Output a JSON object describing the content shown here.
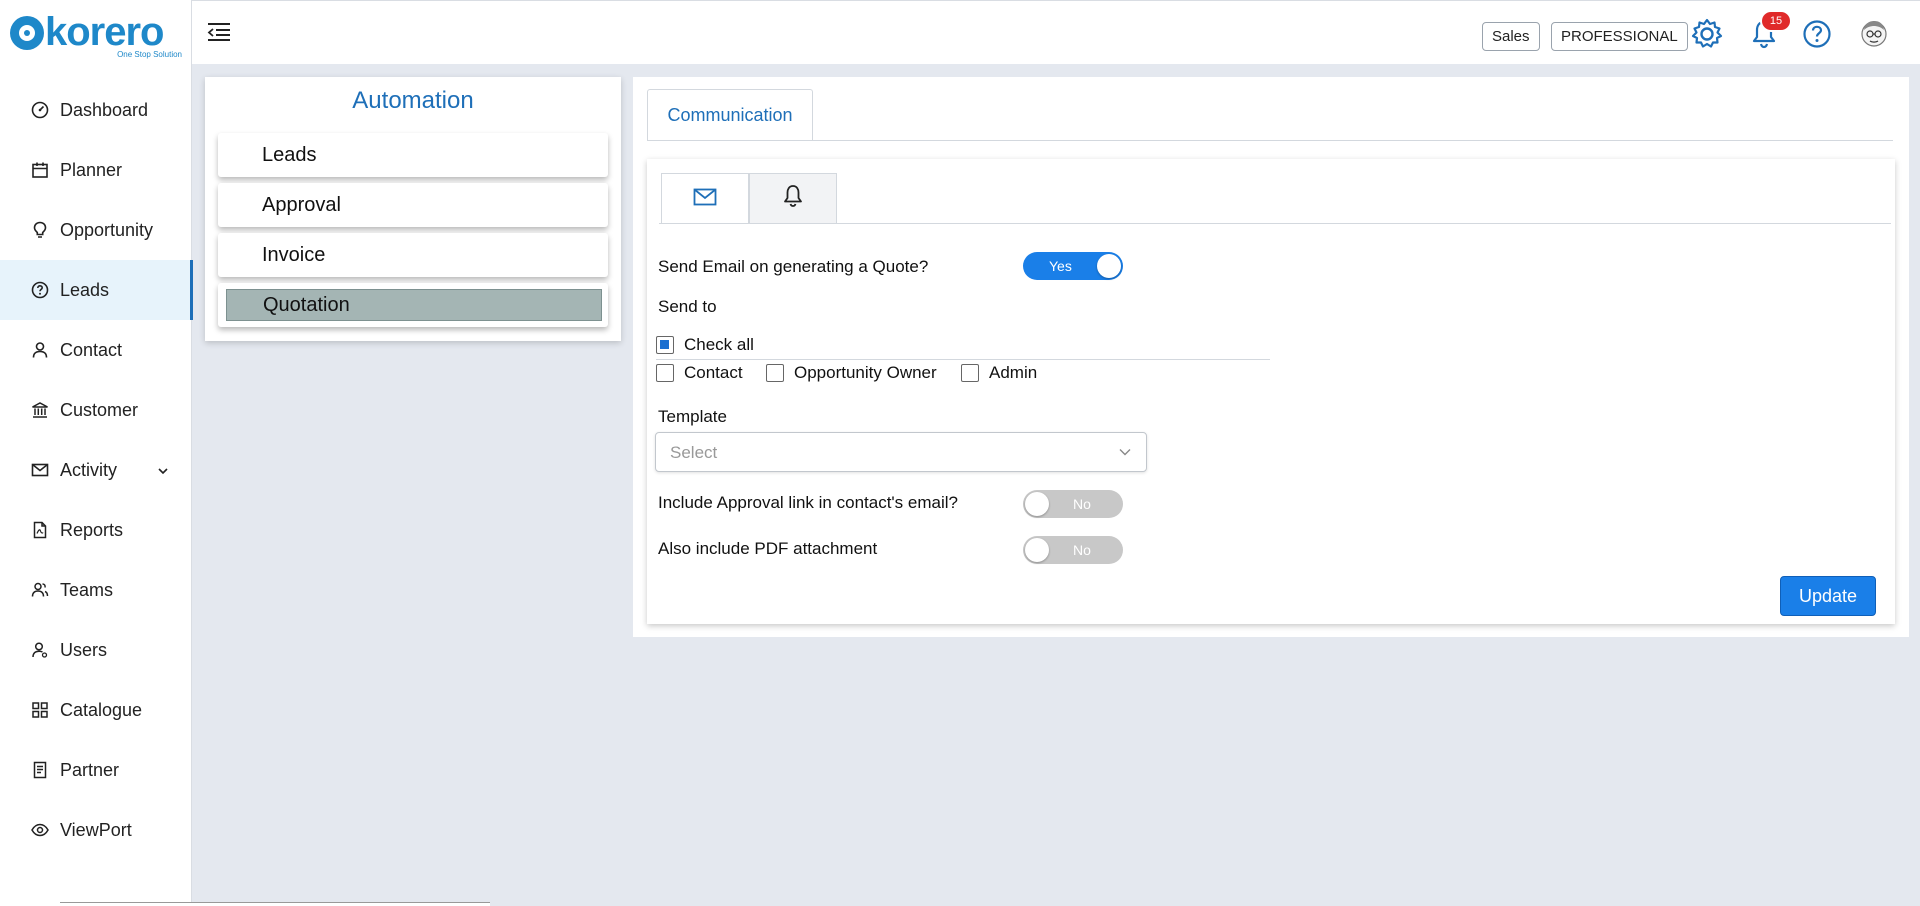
{
  "brand": {
    "name": "korero",
    "tagline": "One Stop Solution"
  },
  "sidebar": {
    "items": [
      {
        "label": "Dashboard",
        "icon": "dashboard-icon"
      },
      {
        "label": "Planner",
        "icon": "calendar-icon"
      },
      {
        "label": "Opportunity",
        "icon": "lightbulb-icon"
      },
      {
        "label": "Leads",
        "icon": "help-circle-icon",
        "active": true
      },
      {
        "label": "Contact",
        "icon": "person-icon"
      },
      {
        "label": "Customer",
        "icon": "bank-icon"
      },
      {
        "label": "Activity",
        "icon": "mail-icon",
        "expandable": true
      },
      {
        "label": "Reports",
        "icon": "pdf-file-icon"
      },
      {
        "label": "Teams",
        "icon": "team-icon"
      },
      {
        "label": "Users",
        "icon": "users-icon"
      },
      {
        "label": "Catalogue",
        "icon": "grid-icon"
      },
      {
        "label": "Partner",
        "icon": "document-icon"
      },
      {
        "label": "ViewPort",
        "icon": "eye-icon"
      }
    ]
  },
  "topbar": {
    "role": "Sales",
    "plan": "PROFESSIONAL",
    "notification_count": "15"
  },
  "automation": {
    "title": "Automation",
    "items": [
      "Leads",
      "Approval",
      "Invoice",
      "Quotation"
    ],
    "selected": "Quotation"
  },
  "communication": {
    "tab_label": "Communication",
    "sub_tabs": [
      "email-icon",
      "bell-icon"
    ],
    "send_email_label": "Send Email on generating a Quote?",
    "send_email_toggle": "Yes",
    "send_to_label": "Send to",
    "check_all_label": "Check all",
    "recipients": [
      "Contact",
      "Opportunity Owner",
      "Admin"
    ],
    "template_label": "Template",
    "template_placeholder": "Select",
    "approval_link_label": "Include Approval link in contact's email?",
    "approval_link_toggle": "No",
    "pdf_label": "Also include PDF attachment",
    "pdf_toggle": "No",
    "update_label": "Update"
  },
  "colors": {
    "primary": "#1e6fb8",
    "accent_blue": "#1a7fe8",
    "badge_red": "#e02a2a",
    "selected_item": "#a4b5b4"
  }
}
